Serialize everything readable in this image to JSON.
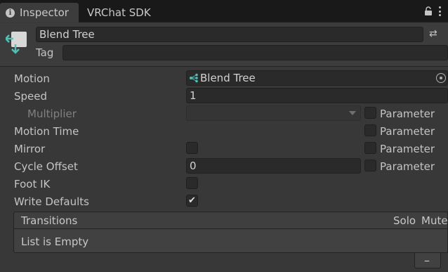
{
  "tabs": [
    {
      "label": "Inspector",
      "icon": "info-icon",
      "active": true
    },
    {
      "label": "VRChat SDK",
      "active": false
    }
  ],
  "header": {
    "object_name": "Blend Tree",
    "tag_label": "Tag",
    "tag_value": ""
  },
  "properties": {
    "motion": {
      "label": "Motion",
      "value": "Blend Tree"
    },
    "speed": {
      "label": "Speed",
      "value": "1"
    },
    "multiplier": {
      "label": "Multiplier",
      "value": "",
      "param_label": "Parameter",
      "param_checked": false
    },
    "motion_time": {
      "label": "Motion Time",
      "param_label": "Parameter",
      "param_checked": false
    },
    "mirror": {
      "label": "Mirror",
      "checked": false,
      "param_label": "Parameter",
      "param_checked": false
    },
    "cycle_offset": {
      "label": "Cycle Offset",
      "value": "0",
      "param_label": "Parameter",
      "param_checked": false
    },
    "foot_ik": {
      "label": "Foot IK",
      "checked": false
    },
    "write_defaults": {
      "label": "Write Defaults",
      "checked": true,
      "check_glyph": "✔"
    }
  },
  "transitions": {
    "title": "Transitions",
    "solo_label": "Solo",
    "mute_label": "Mute",
    "empty_text": "List is Empty",
    "remove_label": "–"
  },
  "colors": {
    "accent_teal": "#4fc1b4",
    "background": "#383838"
  }
}
